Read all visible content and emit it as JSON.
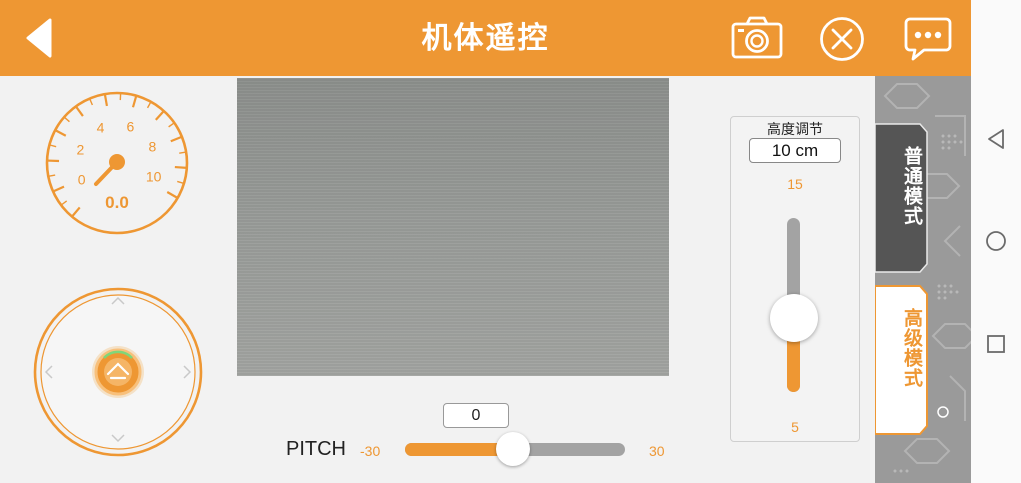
{
  "header": {
    "title": "机体遥控",
    "icons": {
      "back": "back-arrow-icon",
      "camera": "camera-icon",
      "close": "close-circle-icon",
      "message": "chat-bubble-icon"
    }
  },
  "gauge": {
    "ticks": [
      "0",
      "2",
      "4",
      "6",
      "8",
      "10"
    ],
    "value": "0.0"
  },
  "joystick": {
    "icons": [
      "chevron-up-icon",
      "chevron-down-icon",
      "chevron-left-icon",
      "chevron-right-icon",
      "joystick-knob-icon"
    ]
  },
  "pitch": {
    "label": "PITCH",
    "value": "0",
    "min": "-30",
    "max": "30",
    "current": 0
  },
  "height": {
    "title": "高度调节",
    "value": "10 cm",
    "max": "15",
    "min": "5",
    "current": 10
  },
  "modes": [
    {
      "label": "普通模式",
      "active": true
    },
    {
      "label": "高级模式",
      "active": false
    }
  ],
  "navbar": {
    "icons": [
      "nav-back-icon",
      "nav-home-icon",
      "nav-recents-icon"
    ]
  },
  "colors": {
    "accent": "#ee9733",
    "track": "#a3a3a3",
    "mode_active_bg": "#555555",
    "mode_inactive_bg": "#ffffff"
  }
}
